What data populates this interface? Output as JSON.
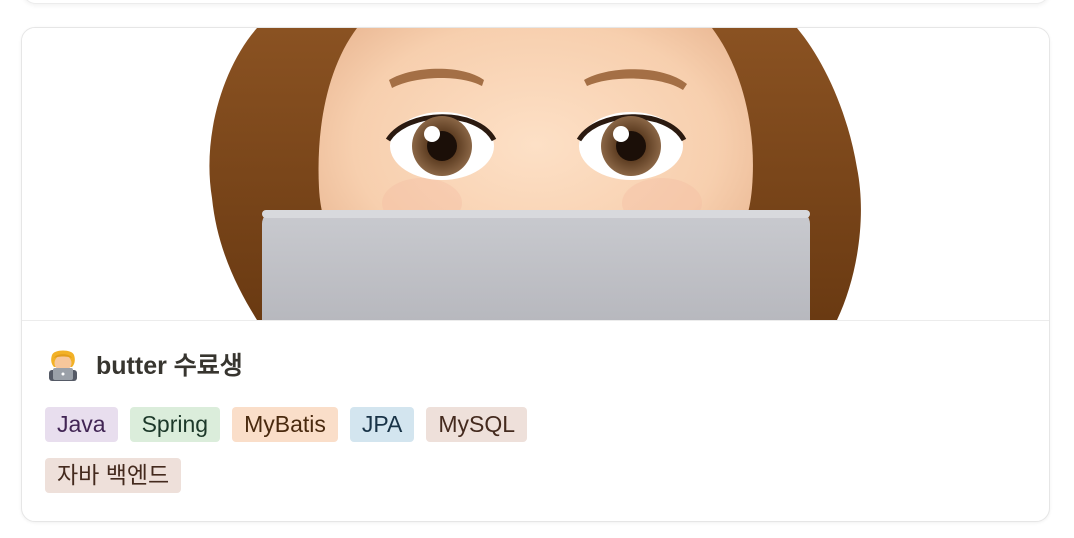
{
  "card": {
    "title": "butter 수료생",
    "icon": "technologist-emoji",
    "cover_image": "memoji-peeking-over-laptop",
    "tags": [
      {
        "label": "Java",
        "bg": "#e8deee",
        "fg": "#412454"
      },
      {
        "label": "Spring",
        "bg": "#dbeddb",
        "fg": "#1c3829"
      },
      {
        "label": "MyBatis",
        "bg": "#fadec9",
        "fg": "#49290e"
      },
      {
        "label": "JPA",
        "bg": "#d3e5ef",
        "fg": "#183347"
      },
      {
        "label": "MySQL",
        "bg": "#eee0da",
        "fg": "#442a1e"
      }
    ],
    "tags_line2": [
      {
        "label": "자바 백엔드",
        "bg": "#eee0da",
        "fg": "#442a1e"
      }
    ]
  }
}
